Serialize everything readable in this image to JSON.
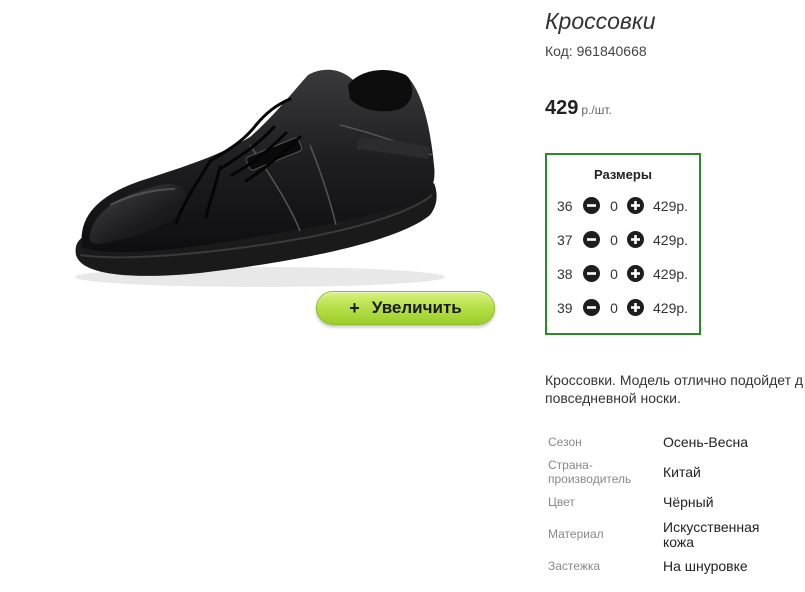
{
  "product": {
    "title": "Кроссовки",
    "sku": "Код: 961840668",
    "price": "429",
    "price_unit": "р./шт."
  },
  "zoom": {
    "plus": "+",
    "label": "Увеличить"
  },
  "sizes": {
    "title": "Размеры",
    "rows": [
      {
        "size": "36",
        "qty": "0",
        "price": "429р."
      },
      {
        "size": "37",
        "qty": "0",
        "price": "429р."
      },
      {
        "size": "38",
        "qty": "0",
        "price": "429р."
      },
      {
        "size": "39",
        "qty": "0",
        "price": "429р."
      }
    ]
  },
  "description": {
    "line1": "Кроссовки. Модель отлично подойдет д",
    "line2": "повседневной носки."
  },
  "specs": [
    {
      "label": "Сезон",
      "value": "Осень-Весна"
    },
    {
      "label": "Страна-производитель",
      "label_line1": "Страна-",
      "label_line2": "производитель",
      "value": "Китай"
    },
    {
      "label": "Цвет",
      "value": "Чёрный"
    },
    {
      "label": "Материал",
      "value": "Искусственная кожа",
      "value_line1": "Искусственная",
      "value_line2": "кожа"
    },
    {
      "label": "Застежка",
      "value": "На шнуровке"
    }
  ],
  "icons": {
    "minus": "minus-circle-icon",
    "plus": "plus-circle-icon"
  },
  "colors": {
    "sizes_border": "#2c8a2c",
    "zoom_button": "#b8e04a"
  }
}
